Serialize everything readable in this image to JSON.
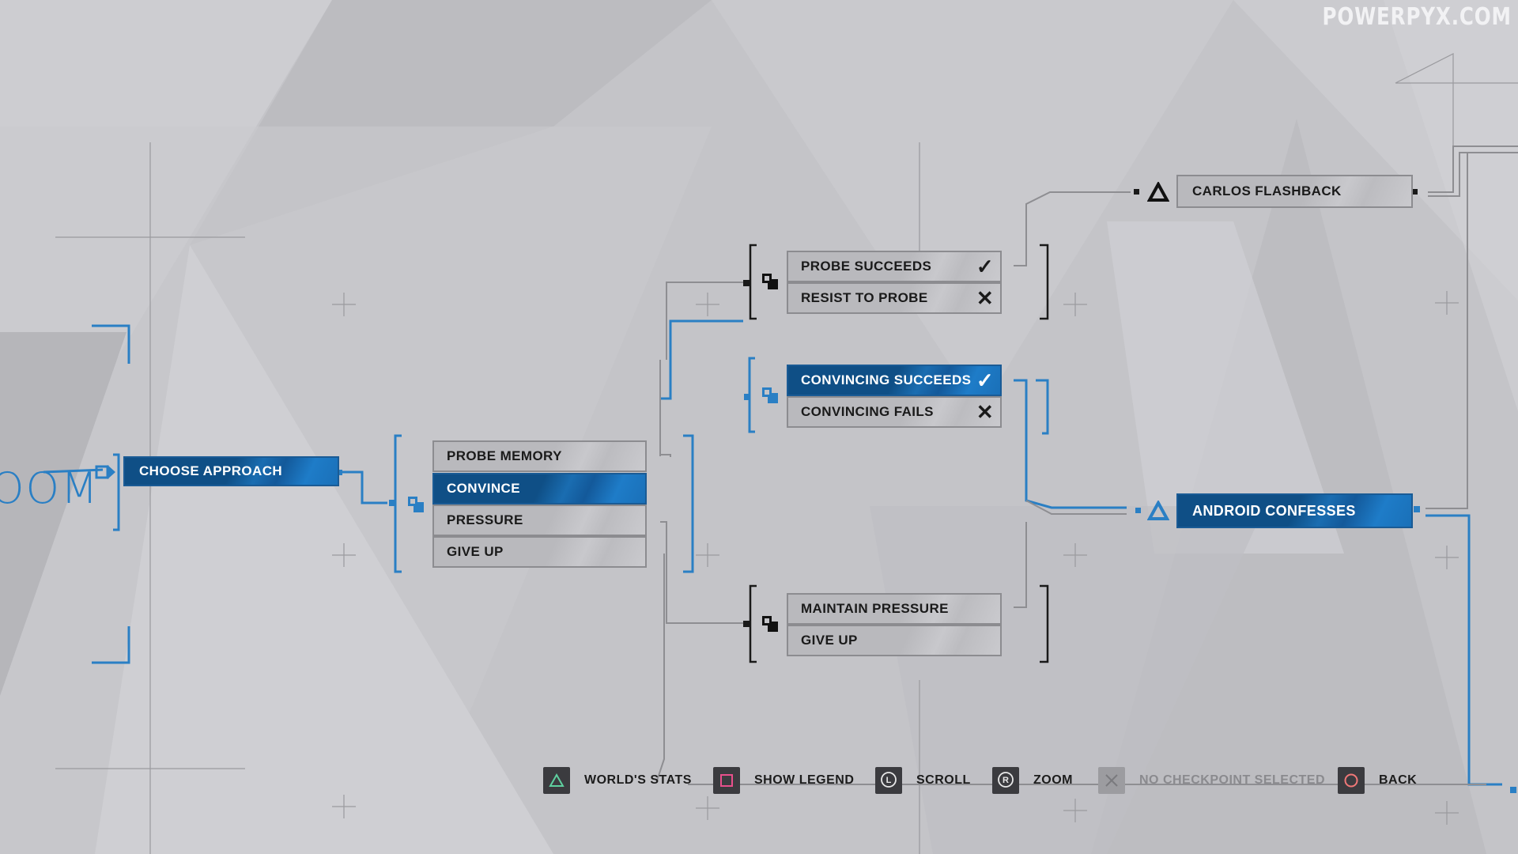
{
  "watermark": "POWERPYX.COM",
  "partial_title": "OOM",
  "colors": {
    "accent_blue": "#1a6db1",
    "selected_dark": "#0f4f86",
    "unselected_box": "#b9b9bd",
    "connector_gray": "#8c8c90",
    "triangle_button": "#5fd0a0",
    "square_button": "#e8508c",
    "circle_button": "#f07878"
  },
  "flowchart": {
    "start_node": {
      "label": "CHOOSE APPROACH",
      "selected": true
    },
    "approach_choices": [
      {
        "label": "PROBE MEMORY",
        "selected": false
      },
      {
        "label": "CONVINCE",
        "selected": true
      },
      {
        "label": "PRESSURE",
        "selected": false
      },
      {
        "label": "GIVE UP",
        "selected": false
      }
    ],
    "probe_outcomes": [
      {
        "label": "PROBE SUCCEEDS",
        "status": "✓",
        "selected": false
      },
      {
        "label": "RESIST TO PROBE",
        "status": "✕",
        "selected": false
      }
    ],
    "convince_outcomes": [
      {
        "label": "CONVINCING SUCCEEDS",
        "status": "✓",
        "selected": true
      },
      {
        "label": "CONVINCING FAILS",
        "status": "✕",
        "selected": false
      }
    ],
    "pressure_outcomes": [
      {
        "label": "MAINTAIN PRESSURE",
        "selected": false
      },
      {
        "label": "GIVE UP",
        "selected": false
      }
    ],
    "endings": [
      {
        "label": "CARLOS FLASHBACK",
        "icon": "triangle-icon",
        "selected": false
      },
      {
        "label": "ANDROID CONFESSES",
        "icon": "triangle-icon",
        "selected": true
      }
    ]
  },
  "controls": [
    {
      "icon": "triangle-button-icon",
      "label": "WORLD'S STATS",
      "enabled": true
    },
    {
      "icon": "square-button-icon",
      "label": "SHOW LEGEND",
      "enabled": true
    },
    {
      "icon": "left-stick-icon",
      "glyph": "L",
      "label": "SCROLL",
      "enabled": true
    },
    {
      "icon": "right-stick-icon",
      "glyph": "R",
      "label": "ZOOM",
      "enabled": true
    },
    {
      "icon": "cross-button-icon",
      "label": "NO CHECKPOINT SELECTED",
      "enabled": false
    },
    {
      "icon": "circle-button-icon",
      "label": "BACK",
      "enabled": true
    }
  ]
}
